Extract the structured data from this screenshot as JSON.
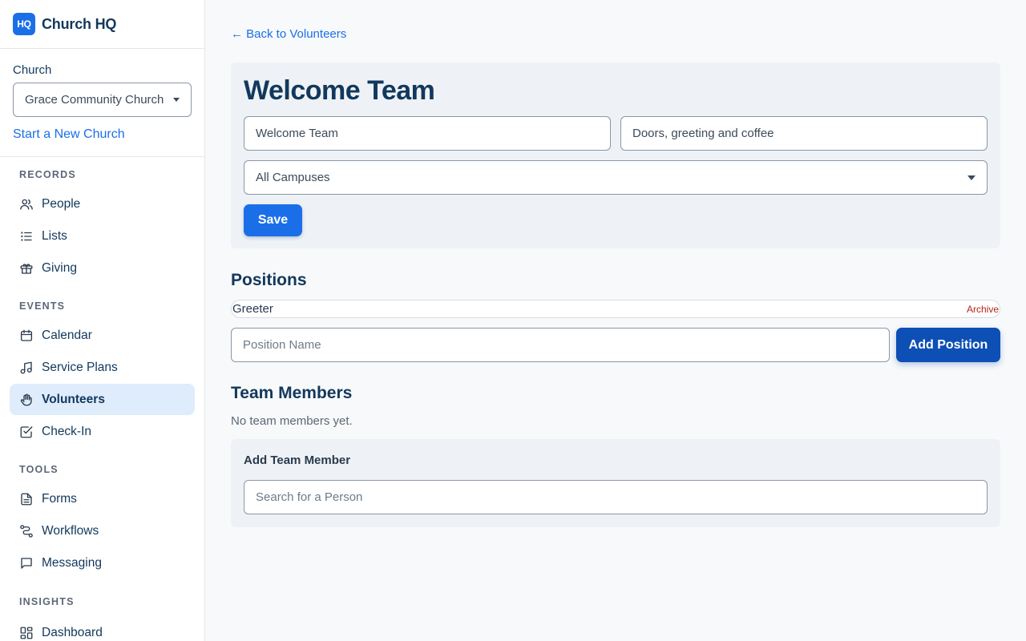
{
  "brand": {
    "logo_text": "HQ",
    "name": "Church HQ",
    "accent": "#1a6fe8"
  },
  "church": {
    "label": "Church",
    "selected": "Grace Community Church",
    "new_church_link": "Start a New Church"
  },
  "nav": {
    "sections": [
      {
        "heading": "RECORDS",
        "items": [
          {
            "label": "People",
            "icon": "people-icon"
          },
          {
            "label": "Lists",
            "icon": "list-icon"
          },
          {
            "label": "Giving",
            "icon": "gift-icon"
          }
        ]
      },
      {
        "heading": "EVENTS",
        "items": [
          {
            "label": "Calendar",
            "icon": "calendar-icon"
          },
          {
            "label": "Service Plans",
            "icon": "music-note-icon"
          },
          {
            "label": "Volunteers",
            "icon": "hand-icon",
            "active": true
          },
          {
            "label": "Check-In",
            "icon": "check-square-icon"
          }
        ]
      },
      {
        "heading": "TOOLS",
        "items": [
          {
            "label": "Forms",
            "icon": "document-icon"
          },
          {
            "label": "Workflows",
            "icon": "workflow-icon"
          },
          {
            "label": "Messaging",
            "icon": "message-icon"
          }
        ]
      },
      {
        "heading": "INSIGHTS",
        "items": [
          {
            "label": "Dashboard",
            "icon": "dashboard-icon"
          }
        ]
      }
    ]
  },
  "main": {
    "back_link": "← Back to Volunteers",
    "team": {
      "title": "Welcome Team",
      "name_value": "Welcome Team",
      "description_value": "Doors, greeting and coffee",
      "campus_selected": "All Campuses",
      "save_label": "Save"
    },
    "positions": {
      "heading": "Positions",
      "items": [
        {
          "name": "Greeter",
          "archive_label": "Archive"
        }
      ],
      "new_position_placeholder": "Position Name",
      "add_label": "Add Position"
    },
    "members": {
      "heading": "Team Members",
      "empty_text": "No team members yet.",
      "add_card_title": "Add Team Member",
      "search_placeholder": "Search for a Person"
    }
  }
}
